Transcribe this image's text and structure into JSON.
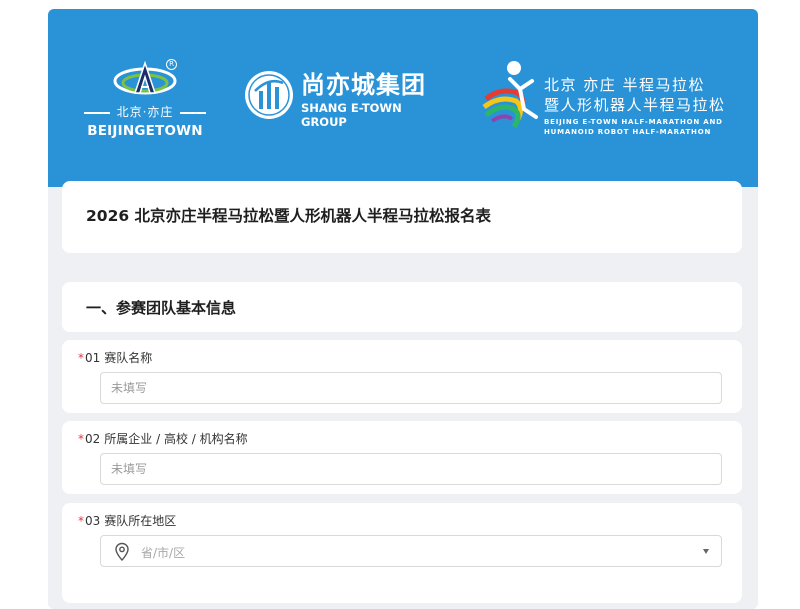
{
  "logos": {
    "etown_cn": "北京·亦庄",
    "etown_en": "BEIJINGETOWN",
    "shang_cn": "尚亦城集团",
    "shang_en": "SHANG E-TOWN GROUP",
    "marathon_line1": "北京 亦庄 半程马拉松",
    "marathon_line2": "暨人形机器人半程马拉松",
    "marathon_line3": "BEIJING E-TOWN HALF-MARATHON AND",
    "marathon_line4": "HUMANOID ROBOT HALF-MARATHON"
  },
  "form": {
    "title": "2026 北京亦庄半程马拉松暨人形机器人半程马拉松报名表",
    "section1_title": "一、参赛团队基本信息",
    "questions": [
      {
        "required_mark": "*",
        "number": "01",
        "label": "赛队名称",
        "placeholder": "未填写"
      },
      {
        "required_mark": "*",
        "number": "02",
        "label": "所属企业 / 高校 / 机构名称",
        "placeholder": "未填写"
      },
      {
        "required_mark": "*",
        "number": "03",
        "label": "赛队所在地区",
        "placeholder": "省/市/区"
      }
    ]
  },
  "colors": {
    "banner": "#2a93d8",
    "required": "#e0383e"
  },
  "icons": {
    "location": "map-pin-icon",
    "dropdown": "caret-down-icon"
  }
}
